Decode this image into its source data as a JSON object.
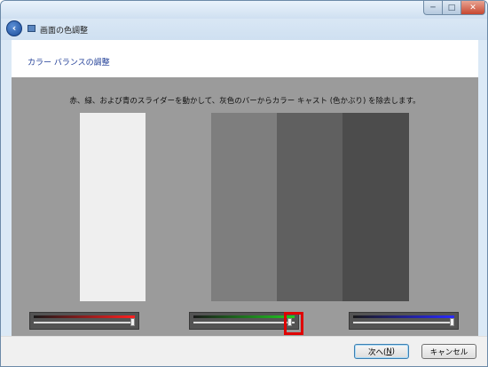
{
  "window": {
    "title": "画面の色調整",
    "controls": {
      "minimize": "─",
      "maximize": "□",
      "close": "✕"
    }
  },
  "nav": {
    "back_icon": "arrow-left-icon",
    "title": "画面の色調整"
  },
  "heading": "カラー バランスの調整",
  "instruction": "赤、緑、および青のスライダーを動かして、灰色のバーからカラー キャスト (色かぶり) を除去します。",
  "gray_bars": [
    "#efefef",
    "#9b9b9b",
    "#7e7e7e",
    "#606060",
    "#4c4c4c"
  ],
  "sliders": [
    {
      "color": "red",
      "accent": "#ff2020",
      "value": 1.0
    },
    {
      "color": "green",
      "accent": "#22cc22",
      "value": 0.97
    },
    {
      "color": "blue",
      "accent": "#2a2aff",
      "value": 1.0
    }
  ],
  "footer": {
    "next_label": "次へ(",
    "next_key": "N",
    "next_suffix": ")",
    "cancel_label": "キャンセル"
  },
  "highlight_color": "#e00000"
}
